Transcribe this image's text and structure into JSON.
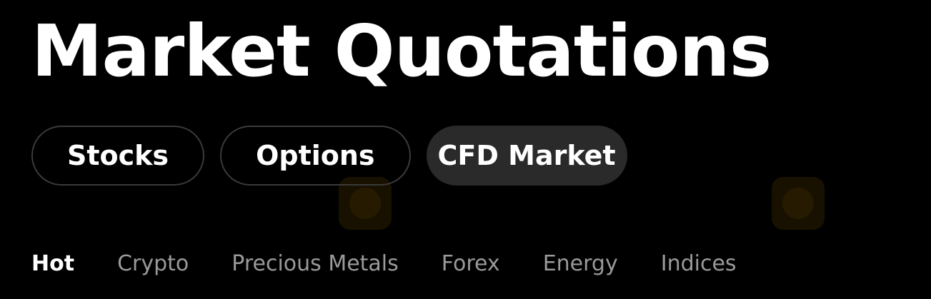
{
  "header": {
    "title": "Market Quotations"
  },
  "market_tabs": [
    {
      "label": "Stocks",
      "active": false
    },
    {
      "label": "Options",
      "active": false
    },
    {
      "label": "CFD Market",
      "active": true
    }
  ],
  "category_tabs": [
    {
      "label": "Hot",
      "active": true
    },
    {
      "label": "Crypto",
      "active": false
    },
    {
      "label": "Precious Metals",
      "active": false
    },
    {
      "label": "Forex",
      "active": false
    },
    {
      "label": "Energy",
      "active": false
    },
    {
      "label": "Indices",
      "active": false
    }
  ],
  "colors": {
    "background": "#000000",
    "text_primary": "#ffffff",
    "text_secondary": "#9a9a9a",
    "tab_border": "#3a3a3a",
    "tab_active_bg": "#2a2a2a"
  },
  "icons": {
    "watermark": "watermark-logo-icon"
  }
}
